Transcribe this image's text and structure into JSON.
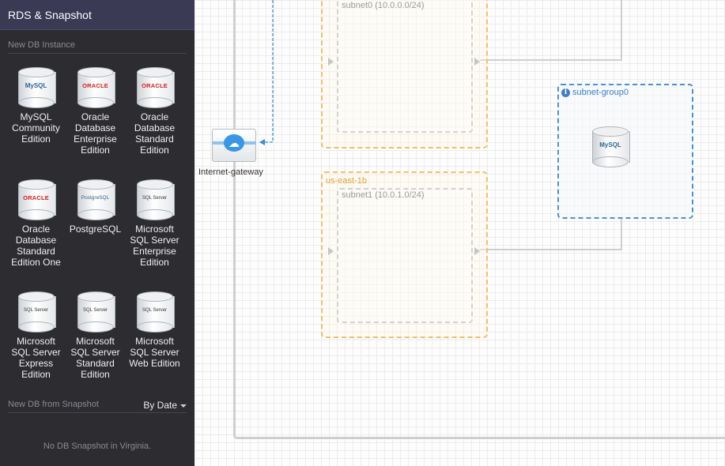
{
  "sidebar": {
    "title": "RDS & Snapshot",
    "new_instance_label": "New DB Instance",
    "instances": [
      {
        "logo": "MySQL",
        "logo_icon": "mysql-logo-icon",
        "label": "MySQL Community Edition"
      },
      {
        "logo": "ORACLE",
        "logo_icon": "oracle-logo-icon",
        "label": "Oracle Database Enterprise Edition"
      },
      {
        "logo": "ORACLE",
        "logo_icon": "oracle-logo-icon",
        "label": "Oracle Database Standard Edition"
      },
      {
        "logo": "ORACLE",
        "logo_icon": "oracle-logo-icon",
        "label": "Oracle Database Standard Edition One"
      },
      {
        "logo": "PostgreSQL",
        "logo_icon": "postgresql-logo-icon",
        "label": "PostgreSQL"
      },
      {
        "logo": "SQL Server",
        "logo_icon": "sql-server-logo-icon",
        "label": "Microsoft SQL Server Enterprise Edition"
      },
      {
        "logo": "SQL Server",
        "logo_icon": "sql-server-logo-icon",
        "label": "Microsoft SQL Server Express Edition"
      },
      {
        "logo": "SQL Server",
        "logo_icon": "sql-server-logo-icon",
        "label": "Microsoft SQL Server Standard Edition"
      },
      {
        "logo": "SQL Server",
        "logo_icon": "sql-server-logo-icon",
        "label": "Microsoft SQL Server Web Edition"
      }
    ],
    "snapshot_label": "New DB from Snapshot",
    "sort_label": "By Date",
    "empty_snapshot_text": "No DB Snapshot in Virginia."
  },
  "canvas": {
    "zones": [
      {
        "label": "",
        "subnet": "subnet0 (10.0.0.0/24)"
      },
      {
        "label": "us-east-1b",
        "subnet": "subnet1 (10.0.1.0/24)"
      }
    ],
    "subnet_group": {
      "label": "subnet-group0",
      "instance_logo": "MySQL"
    },
    "gateway": {
      "label": "Internet-gateway"
    }
  },
  "colors": {
    "sidebar_bg": "#2c2c31",
    "header_bg": "#3a3a55",
    "az_border": "#f1bf6a",
    "subnet_group_border": "#4a8fdb",
    "gateway_blue": "#3a97e3"
  }
}
